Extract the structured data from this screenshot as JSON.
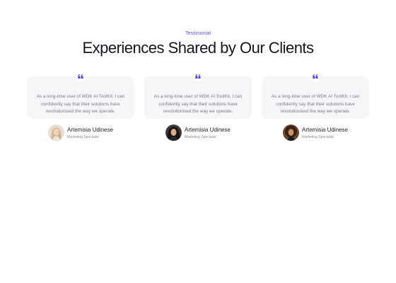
{
  "section": {
    "eyebrow": "Testimonial",
    "heading": "Experiences Shared by Our Clients"
  },
  "colors": {
    "accent": "#4f46e5",
    "card_background": "#f6f6f9",
    "heading": "#16161d",
    "body_text": "#7a7a85"
  },
  "testimonials": [
    {
      "icon": "quote-icon",
      "quote": "As a long-time user of WDK AI ToolKit, I can confidently say that their solutions have revolutionised the way we operate.",
      "name": "Artemisia Udinese",
      "role": "Marketing Specialist",
      "avatar": "avatar-photo-blonde"
    },
    {
      "icon": "quote-icon",
      "quote": "As a long-time user of WDK AI ToolKit, I can confidently say that their solutions have revolutionised the way we operate.",
      "name": "Artemisia Udinese",
      "role": "Marketing Specialist",
      "avatar": "avatar-photo-dark-hair"
    },
    {
      "icon": "quote-icon",
      "quote": "As a long-time user of WDK AI ToolKit, I can confidently say that their solutions have revolutionised the way we operate.",
      "name": "Artemisia Udinese",
      "role": "Marketing Specialist",
      "avatar": "avatar-photo-curly-hair"
    }
  ]
}
